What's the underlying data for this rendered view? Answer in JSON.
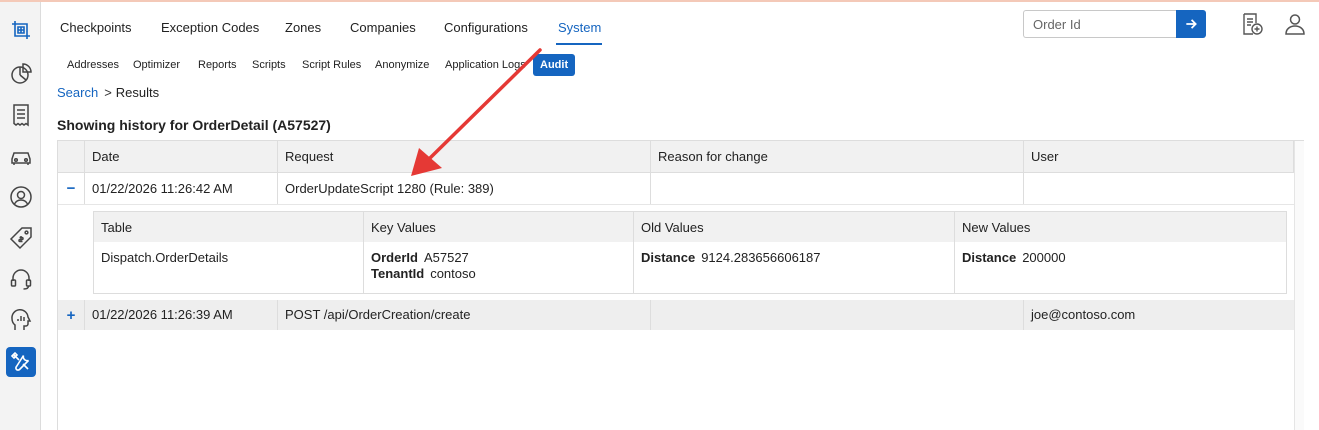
{
  "colors": {
    "accent": "#1565c0",
    "annotation_arrow": "#e53935"
  },
  "sidebar": {
    "items": [
      {
        "name": "logo-icon",
        "active": false
      },
      {
        "name": "dashboard-icon",
        "active": false
      },
      {
        "name": "receipt-icon",
        "active": false
      },
      {
        "name": "vehicle-icon",
        "active": false
      },
      {
        "name": "user-icon",
        "active": false
      },
      {
        "name": "price-tag-icon",
        "active": false
      },
      {
        "name": "support-icon",
        "active": false
      },
      {
        "name": "analytics-icon",
        "active": false
      },
      {
        "name": "tools-icon",
        "active": true
      }
    ]
  },
  "nav": {
    "tabs": [
      "Checkpoints",
      "Exception Codes",
      "Zones",
      "Companies",
      "Configurations",
      "System"
    ],
    "active": "System"
  },
  "subnav": {
    "tabs": [
      "Addresses",
      "Optimizer",
      "Reports",
      "Scripts",
      "Script Rules",
      "Anonymize",
      "Application Logs",
      "Audit"
    ],
    "active": "Audit"
  },
  "header": {
    "search_placeholder": "Order Id",
    "icons": [
      "go-arrow-icon",
      "add-document-icon",
      "profile-icon"
    ]
  },
  "breadcrumb": {
    "link": "Search",
    "separator": ">",
    "current": "Results"
  },
  "page_title": "Showing history for OrderDetail (A57527)",
  "table": {
    "columns": [
      "Date",
      "Request",
      "Reason for change",
      "User"
    ],
    "rows": [
      {
        "toggle": "−",
        "date": "01/22/2026 11:26:42 AM",
        "request": "OrderUpdateScript 1280 (Rule: 389)",
        "reason": "",
        "user": ""
      },
      {
        "toggle": "+",
        "date": "01/22/2026 11:26:39 AM",
        "request": "POST /api/OrderCreation/create",
        "reason": "",
        "user": "joe@contoso.com"
      }
    ],
    "detail": {
      "columns": [
        "Table",
        "Key Values",
        "Old Values",
        "New Values"
      ],
      "row": {
        "table": "Dispatch.OrderDetails",
        "key_values": [
          {
            "key": "OrderId",
            "value": "A57527"
          },
          {
            "key": "TenantId",
            "value": "contoso"
          }
        ],
        "old_values": [
          {
            "key": "Distance",
            "value": "9124.283656606187"
          }
        ],
        "new_values": [
          {
            "key": "Distance",
            "value": "200000"
          }
        ]
      }
    }
  }
}
